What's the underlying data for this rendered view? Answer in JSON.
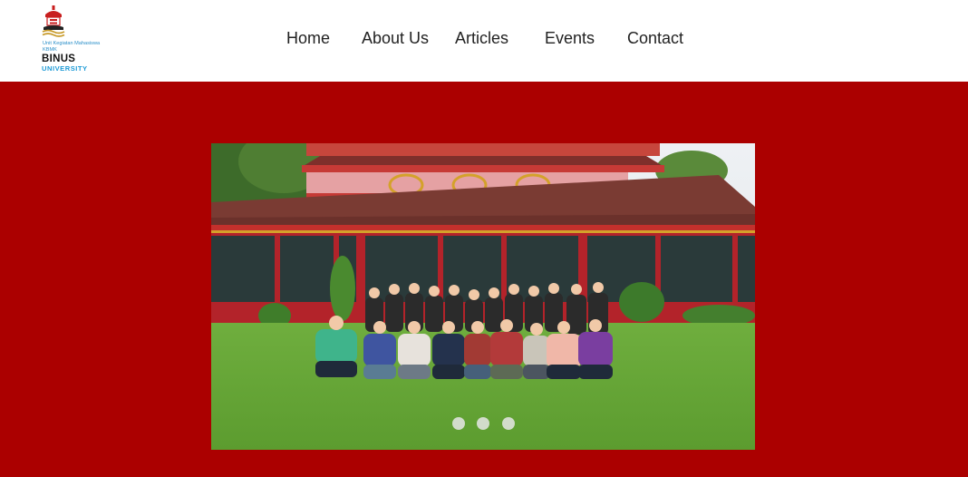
{
  "header": {
    "logo": {
      "ukm_line1": "Unit Kegiatan Mahasiswa",
      "ukm_line2": "KBMK",
      "brand": "BINUS",
      "brand_sub": "UNIVERSITY"
    },
    "nav": [
      "Home",
      "About Us",
      "Articles",
      "Events",
      "Contact"
    ]
  },
  "hero": {
    "background_color": "#ab0000",
    "carousel": {
      "slide_count": 3,
      "photo_description_icon": "group-photo-image"
    }
  }
}
